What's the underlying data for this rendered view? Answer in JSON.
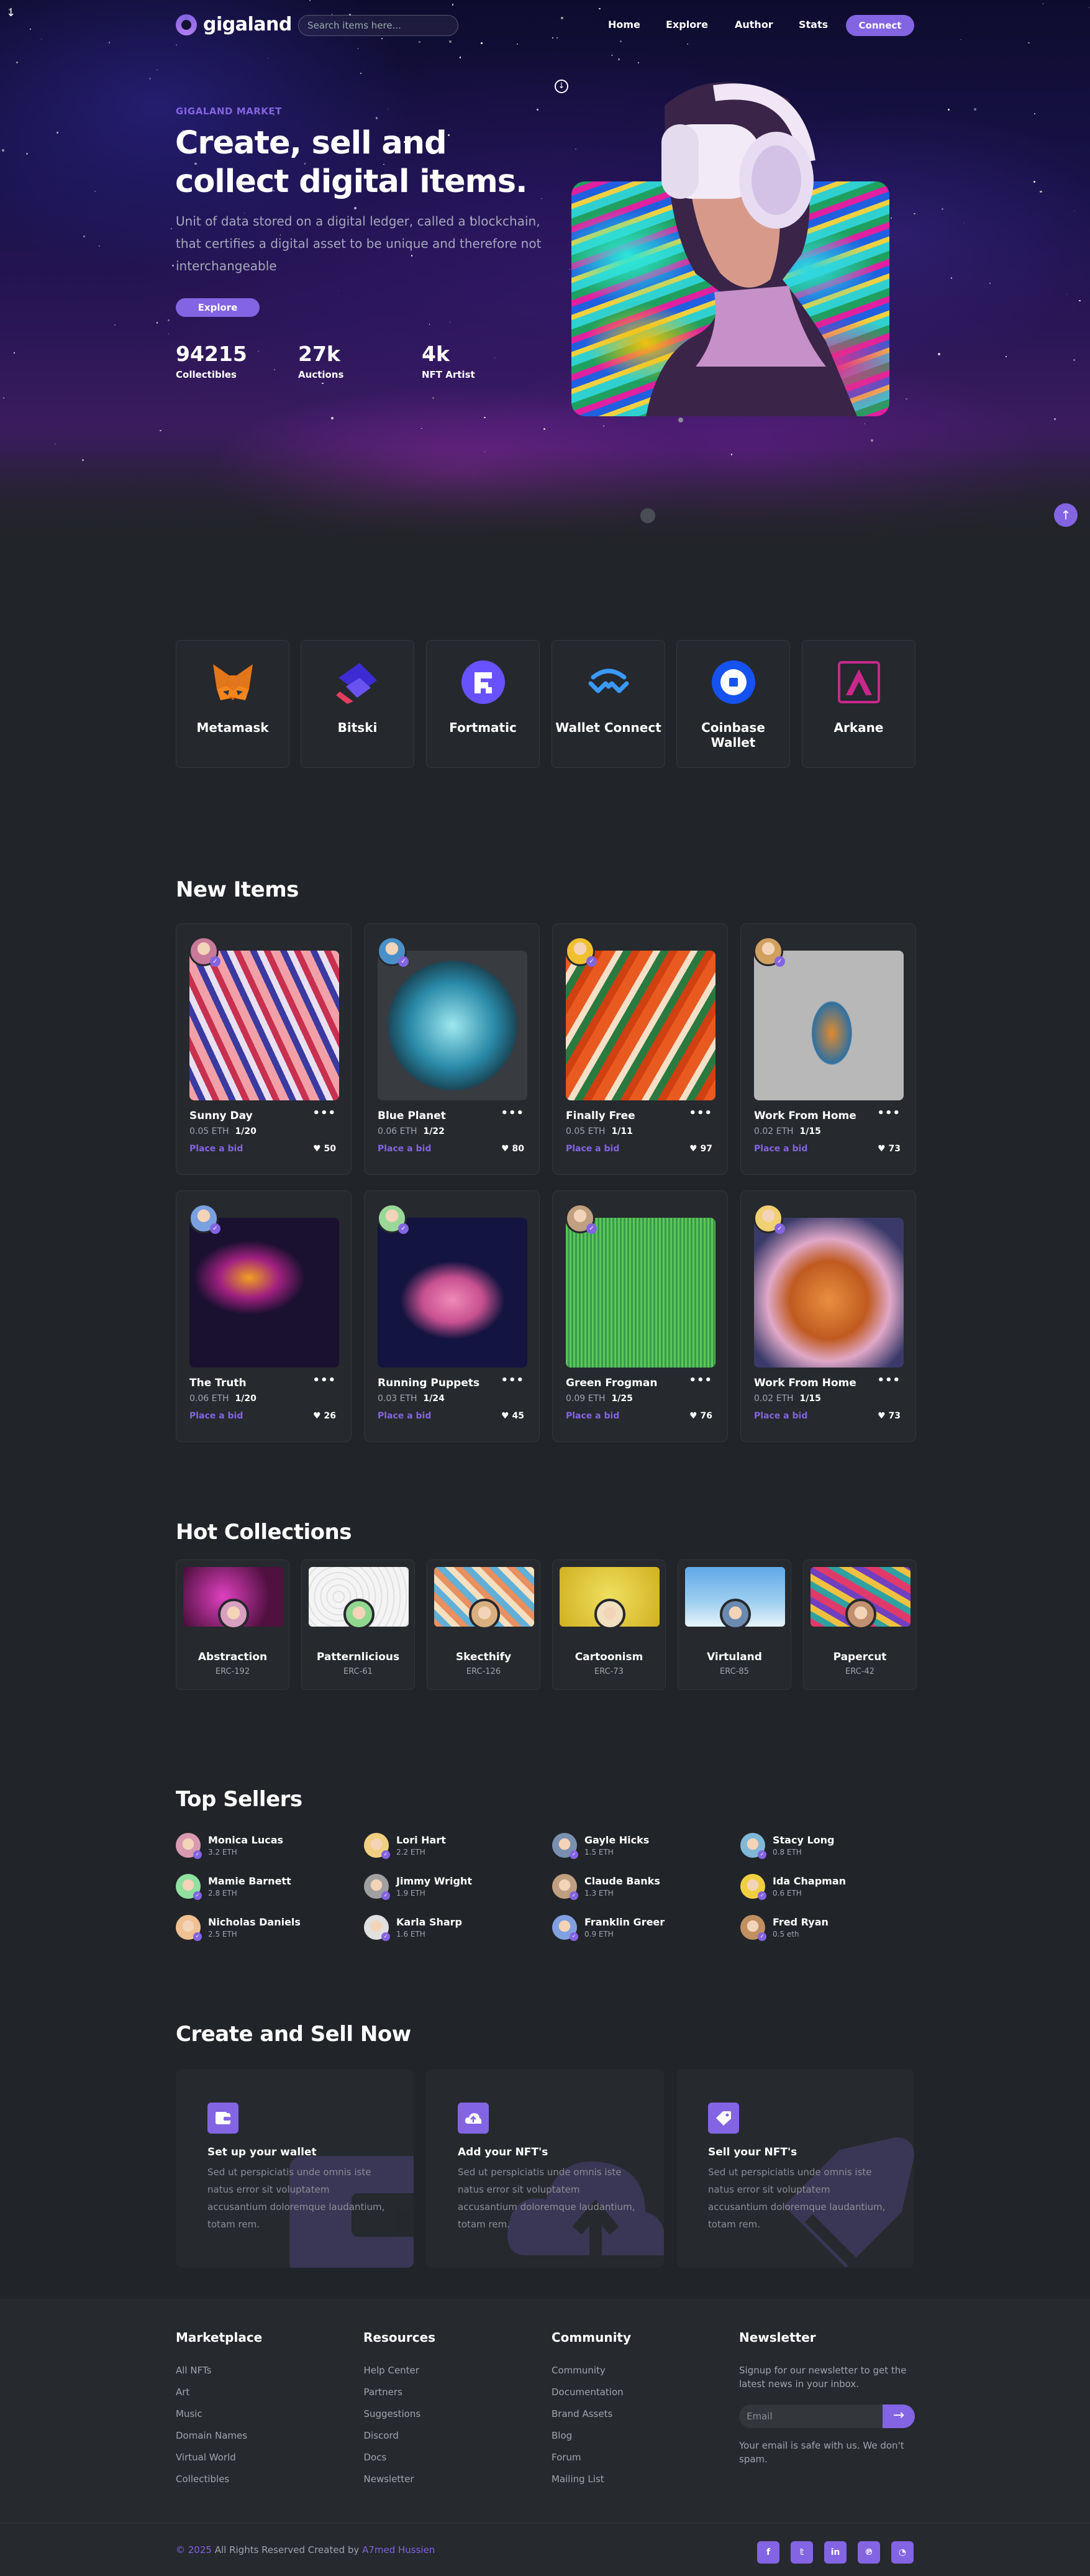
{
  "brand": {
    "name": "gigaland",
    "accent": "#8364e2",
    "bg": "#212428"
  },
  "nav": {
    "search_placeholder": "Search items here...",
    "items": [
      "Home",
      "Explore",
      "Author",
      "Stats"
    ],
    "connect": "Connect"
  },
  "hero": {
    "eyebrow": "GIGALAND MARKET",
    "title": "Create, sell and collect digital items.",
    "description": "Unit of data stored on a digital ledger, called a blockchain, that certifies a digital asset to be unique and therefore not interchangeable",
    "button": "Explore",
    "stats": [
      {
        "value": "94215",
        "label": "Collectibles"
      },
      {
        "value": "27k",
        "label": "Auctions"
      },
      {
        "value": "4k",
        "label": "NFT Artist"
      }
    ]
  },
  "wallets": [
    {
      "name": "Metamask",
      "icon": "metamask-fox-icon"
    },
    {
      "name": "Bitski",
      "icon": "bitski-icon"
    },
    {
      "name": "Fortmatic",
      "icon": "fortmatic-icon"
    },
    {
      "name": "Wallet Connect",
      "icon": "walletconnect-icon"
    },
    {
      "name": "Coinbase Wallet",
      "icon": "coinbase-icon"
    },
    {
      "name": "Arkane",
      "icon": "arkane-icon"
    }
  ],
  "new_items": {
    "heading": "New Items",
    "bid_label": "Place a bid",
    "items": [
      {
        "name": "Sunny Day",
        "price": "0.05 ETH",
        "count": "1/20",
        "likes": "50"
      },
      {
        "name": "Blue Planet",
        "price": "0.06 ETH",
        "count": "1/22",
        "likes": "80"
      },
      {
        "name": "Finally Free",
        "price": "0.05 ETH",
        "count": "1/11",
        "likes": "97"
      },
      {
        "name": "Work From Home",
        "price": "0.02 ETH",
        "count": "1/15",
        "likes": "73"
      },
      {
        "name": "The Truth",
        "price": "0.06 ETH",
        "count": "1/20",
        "likes": "26"
      },
      {
        "name": "Running Puppets",
        "price": "0.03 ETH",
        "count": "1/24",
        "likes": "45"
      },
      {
        "name": "Green Frogman",
        "price": "0.09 ETH",
        "count": "1/25",
        "likes": "76"
      },
      {
        "name": "Work From Home",
        "price": "0.02 ETH",
        "count": "1/15",
        "likes": "73"
      }
    ]
  },
  "hot_collections": {
    "heading": "Hot Collections",
    "items": [
      {
        "name": "Abstraction",
        "standard": "ERC-192"
      },
      {
        "name": "Patternlicious",
        "standard": "ERC-61"
      },
      {
        "name": "Skecthify",
        "standard": "ERC-126"
      },
      {
        "name": "Cartoonism",
        "standard": "ERC-73"
      },
      {
        "name": "Virtuland",
        "standard": "ERC-85"
      },
      {
        "name": "Papercut",
        "standard": "ERC-42"
      }
    ]
  },
  "top_sellers": {
    "heading": "Top Sellers",
    "items": [
      {
        "name": "Monica Lucas",
        "eth": "3.2 ETH"
      },
      {
        "name": "Lori Hart",
        "eth": "2.2 ETH"
      },
      {
        "name": "Gayle Hicks",
        "eth": "1.5 ETH"
      },
      {
        "name": "Stacy Long",
        "eth": "0.8 ETH"
      },
      {
        "name": "Mamie Barnett",
        "eth": "2.8 ETH"
      },
      {
        "name": "Jimmy Wright",
        "eth": "1.9 ETH"
      },
      {
        "name": "Claude Banks",
        "eth": "1.3 ETH"
      },
      {
        "name": "Ida Chapman",
        "eth": "0.6 ETH"
      },
      {
        "name": "Nicholas Daniels",
        "eth": "2.5 ETH"
      },
      {
        "name": "Karla Sharp",
        "eth": "1.6 ETH"
      },
      {
        "name": "Franklin Greer",
        "eth": "0.9 ETH"
      },
      {
        "name": "Fred Ryan",
        "eth": "0.5 eth"
      }
    ]
  },
  "create_sell": {
    "heading": "Create and Sell Now",
    "cards": [
      {
        "title": "Set up your wallet",
        "text": "Sed ut perspiciatis unde omnis iste natus error sit voluptatem accusantium doloremque laudantium, totam rem.",
        "icon": "wallet-icon"
      },
      {
        "title": "Add your NFT's",
        "text": "Sed ut perspiciatis unde omnis iste natus error sit voluptatem accusantium doloremque laudantium, totam rem.",
        "icon": "cloud-upload-icon"
      },
      {
        "title": "Sell your NFT's",
        "text": "Sed ut perspiciatis unde omnis iste natus error sit voluptatem accusantium doloremque laudantium, totam rem.",
        "icon": "tags-icon"
      }
    ]
  },
  "footer": {
    "columns": [
      {
        "title": "Marketplace",
        "links": [
          "All NFTs",
          "Art",
          "Music",
          "Domain Names",
          "Virtual World",
          "Collectibles"
        ]
      },
      {
        "title": "Resources",
        "links": [
          "Help Center",
          "Partners",
          "Suggestions",
          "Discord",
          "Docs",
          "Newsletter"
        ]
      },
      {
        "title": "Community",
        "links": [
          "Community",
          "Documentation",
          "Brand Assets",
          "Blog",
          "Forum",
          "Mailing List"
        ]
      }
    ],
    "newsletter": {
      "title": "Newsletter",
      "text": "Signup for our newsletter to get the latest news in your inbox.",
      "placeholder": "Email",
      "note": "Your email is safe with us. We don't spam."
    },
    "copyright_year": "© 2025",
    "copyright_text": " All Rights Reserved Created by ",
    "copyright_author": "A7med Hussien",
    "social": [
      "facebook-icon",
      "twitter-icon",
      "linkedin-icon",
      "pinterest-icon",
      "rss-icon"
    ]
  }
}
